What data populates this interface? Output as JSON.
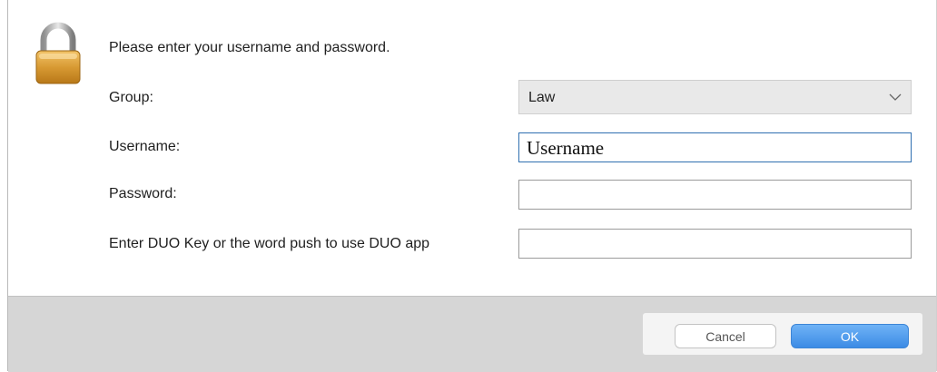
{
  "dialog": {
    "prompt": "Please enter your username and password.",
    "icon": "padlock-icon"
  },
  "form": {
    "group_label": "Group:",
    "group_value": "Law",
    "username_label": "Username:",
    "username_value": "Username",
    "password_label": "Password:",
    "password_value": "",
    "duo_label": "Enter DUO Key or the word push to use DUO app",
    "duo_value": ""
  },
  "buttons": {
    "cancel": "Cancel",
    "ok": "OK"
  },
  "colors": {
    "ok_button": "#4a97ec",
    "focus_border": "#2f6fb0",
    "footer": "#d6d6d6"
  }
}
